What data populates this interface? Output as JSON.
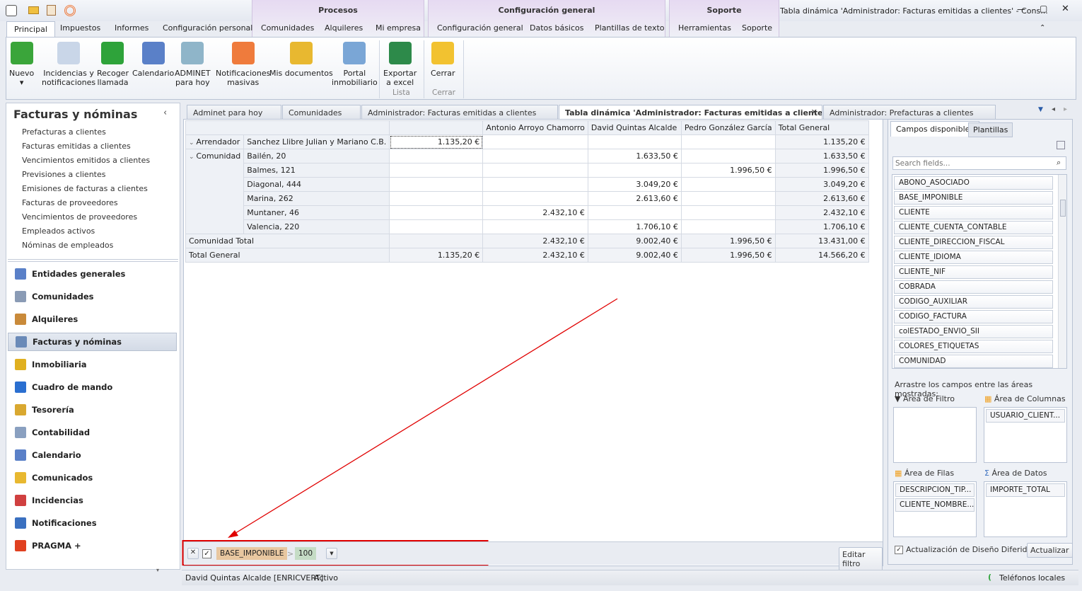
{
  "window": {
    "title": "Tabla dinámica 'Administrador: Facturas emitidas a clientes' - Cons...",
    "icons": [
      "app-icon",
      "mail-icon",
      "clipboard-icon",
      "broadcast-icon"
    ]
  },
  "context_groups": [
    {
      "label": "Procesos"
    },
    {
      "label": "Configuración general"
    },
    {
      "label": "Soporte"
    }
  ],
  "ribbon_tabs": [
    "Principal",
    "Impuestos",
    "Informes",
    "Configuración personal",
    "Comunidades",
    "Alquileres",
    "Mi empresa",
    "Configuración general",
    "Datos básicos",
    "Plantillas de texto",
    "Herramientas",
    "Soporte"
  ],
  "ribbon_buttons": [
    {
      "l1": "Nuevo",
      "l2": "▾",
      "icon": "new-document-icon",
      "color": "#3aa53a"
    },
    {
      "l1": "Incidencias y",
      "l2": "notificaciones",
      "icon": "incidents-icon",
      "color": "#c9d6e8"
    },
    {
      "l1": "Recoger",
      "l2": "llamada",
      "icon": "phone-icon",
      "color": "#2ea33a"
    },
    {
      "l1": "Calendario",
      "l2": "",
      "icon": "calendar-icon",
      "color": "#5a80c8"
    },
    {
      "l1": "ADMINET",
      "l2": "para hoy",
      "icon": "clock-icon",
      "color": "#8fb5c9"
    },
    {
      "l1": "Notificaciones",
      "l2": "masivas",
      "icon": "broadcast-icon",
      "color": "#ef7b3c"
    },
    {
      "l1": "Mis documentos",
      "l2": "",
      "icon": "folder-icon",
      "color": "#e8b830"
    },
    {
      "l1": "Portal",
      "l2": "inmobiliario",
      "icon": "portal-icon",
      "color": "#7aa6d6"
    },
    {
      "l1": "Exportar",
      "l2": "a excel",
      "icon": "excel-icon",
      "color": "#2d8a4a"
    },
    {
      "l1": "Cerrar",
      "l2": "",
      "icon": "close-folder-icon",
      "color": "#f2c230"
    }
  ],
  "ribbon_groups": [
    "Lista",
    "Cerrar"
  ],
  "left": {
    "title": "Facturas y nóminas",
    "links": [
      "Prefacturas a clientes",
      "Facturas emitidas a clientes",
      "Vencimientos emitidos a clientes",
      "Previsiones a clientes",
      "Emisiones de facturas a clientes",
      "Facturas de proveedores",
      "Vencimientos de proveedores",
      "Empleados activos",
      "Nóminas de empleados"
    ],
    "nav": [
      {
        "label": "Entidades generales",
        "color": "#5a80c8"
      },
      {
        "label": "Comunidades",
        "color": "#8a9bb5"
      },
      {
        "label": "Alquileres",
        "color": "#c98a3a"
      },
      {
        "label": "Facturas y nóminas",
        "color": "#6a8ab8"
      },
      {
        "label": "Inmobiliaria",
        "color": "#e0b020"
      },
      {
        "label": "Cuadro de mando",
        "color": "#2a6fd0"
      },
      {
        "label": "Tesorería",
        "color": "#d9a830"
      },
      {
        "label": "Contabilidad",
        "color": "#8aa0c0"
      },
      {
        "label": "Calendario",
        "color": "#5a80c8"
      },
      {
        "label": "Comunicados",
        "color": "#e8b830"
      },
      {
        "label": "Incidencias",
        "color": "#d04040"
      },
      {
        "label": "Notificaciones",
        "color": "#3a70c0"
      },
      {
        "label": "PRAGMA +",
        "color": "#e04020"
      }
    ]
  },
  "doc_tabs": [
    "Adminet para hoy",
    "Comunidades",
    "Administrador: Facturas emitidas a clientes",
    "Tabla dinámica 'Administrador: Facturas emitidas a clientes'",
    "Administrador: Prefacturas a clientes"
  ],
  "pivot": {
    "columns": [
      "",
      "Antonio Arroyo Chamorro",
      "David Quintas Alcalde",
      "Pedro González García",
      "Total General"
    ],
    "rows": [
      {
        "g": "Arrendador",
        "s": "Sanchez Llibre Julian y Mariano C.B.",
        "v": [
          "1.135,20 €",
          "",
          "",
          "",
          "1.135,20 €"
        ]
      },
      {
        "g": "Comunidad",
        "s": "Bailén, 20",
        "v": [
          "",
          "",
          "1.633,50 €",
          "",
          "1.633,50 €"
        ]
      },
      {
        "g": "",
        "s": "Balmes, 121",
        "v": [
          "",
          "",
          "",
          "1.996,50 €",
          "1.996,50 €"
        ]
      },
      {
        "g": "",
        "s": "Diagonal, 444",
        "v": [
          "",
          "",
          "3.049,20 €",
          "",
          "3.049,20 €"
        ]
      },
      {
        "g": "",
        "s": "Marina, 262",
        "v": [
          "",
          "",
          "2.613,60 €",
          "",
          "2.613,60 €"
        ]
      },
      {
        "g": "",
        "s": "Muntaner, 46",
        "v": [
          "",
          "2.432,10 €",
          "",
          "",
          "2.432,10 €"
        ]
      },
      {
        "g": "",
        "s": "Valencia, 220",
        "v": [
          "",
          "",
          "1.706,10 €",
          "",
          "1.706,10 €"
        ]
      }
    ],
    "totals": [
      {
        "label": "Comunidad Total",
        "v": [
          "",
          "2.432,10 €",
          "9.002,40 €",
          "1.996,50 €",
          "13.431,00 €"
        ]
      },
      {
        "label": "Total General",
        "v": [
          "1.135,20 €",
          "2.432,10 €",
          "9.002,40 €",
          "1.996,50 €",
          "14.566,20 €"
        ]
      }
    ]
  },
  "filter": {
    "field": "BASE_IMPONIBLE",
    "op": ">",
    "value": "100",
    "edit": "Editar filtro",
    "enabled": true
  },
  "fields_panel": {
    "tabs": [
      "Campos disponibles",
      "Plantillas"
    ],
    "search_placeholder": "Search fields...",
    "fields": [
      "ABONO_ASOCIADO",
      "BASE_IMPONIBLE",
      "CLIENTE",
      "CLIENTE_CUENTA_CONTABLE",
      "CLIENTE_DIRECCION_FISCAL",
      "CLIENTE_IDIOMA",
      "CLIENTE_NIF",
      "COBRADA",
      "CODIGO_AUXILIAR",
      "CODIGO_FACTURA",
      "colESTADO_ENVIO_SII",
      "COLORES_ETIQUETAS",
      "COMUNIDAD"
    ],
    "hint": "Arrastre los campos entre las áreas mostradas:",
    "filter_area": "Área de Filtro",
    "columns_area": "Área de Columnas",
    "rows_area": "Área de Filas",
    "data_area": "Área de Datos",
    "columns_fields": [
      "USUARIO_CLIENT..."
    ],
    "rows_fields": [
      "DESCRIPCION_TIP...",
      "CLIENTE_NOMBRE..."
    ],
    "data_fields": [
      "IMPORTE_TOTAL"
    ],
    "deferred": "Actualización de Diseño Diferido",
    "deferred_checked": true,
    "update": "Actualizar"
  },
  "status": {
    "user": "David Quintas Alcalde [ENRICVERT]",
    "state": "Activo",
    "phones": "Teléfonos locales"
  },
  "annotation_color": "#e00000"
}
